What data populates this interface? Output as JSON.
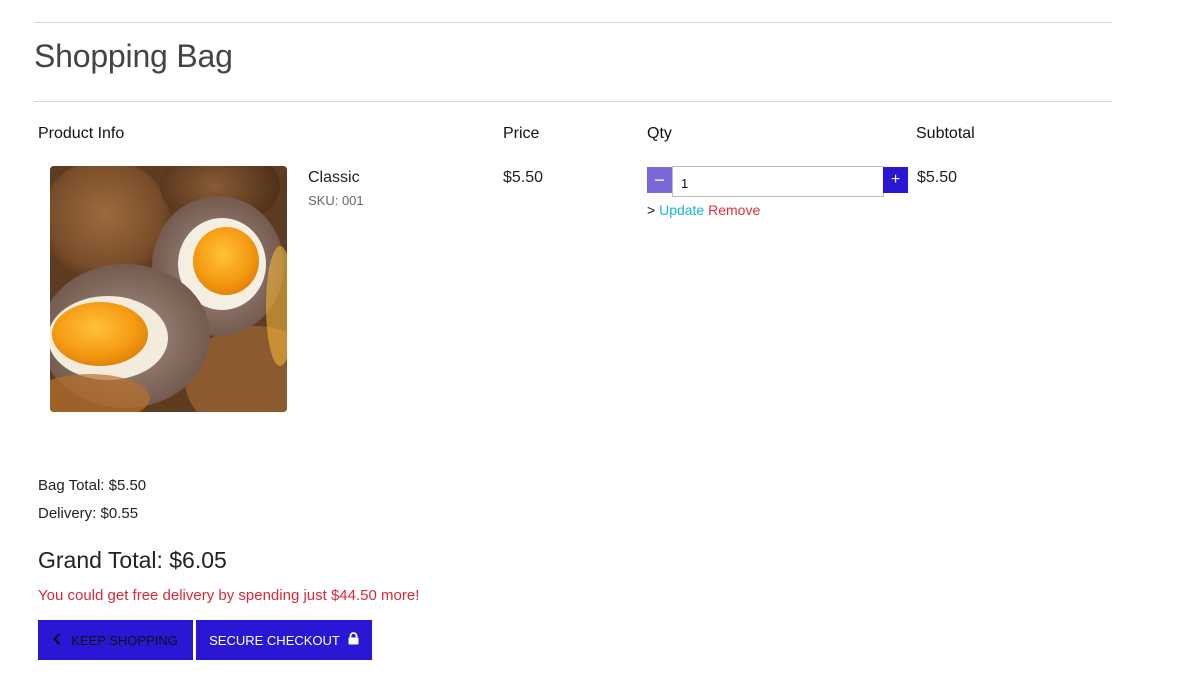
{
  "page": {
    "title": "Shopping Bag"
  },
  "table": {
    "headers": {
      "product": "Product Info",
      "price": "Price",
      "qty": "Qty",
      "subtotal": "Subtotal"
    }
  },
  "item": {
    "name": "Classic",
    "sku": "SKU: 001",
    "price": "$5.50",
    "qty": "1",
    "subtotal": "$5.50",
    "image_icon": "scotch-egg-photo"
  },
  "qty_controls": {
    "minus": "−",
    "plus": "+",
    "prefix": ">",
    "update": "Update",
    "remove": "Remove"
  },
  "totals": {
    "bag_total": "Bag Total: $5.50",
    "delivery": "Delivery: $0.55",
    "grand_total": "Grand Total: $6.05",
    "free_delivery_msg": "You could get free delivery by spending just $44.50 more!"
  },
  "buttons": {
    "keep_shopping": "KEEP SHOPPING",
    "keep_icon": "chevron-left-icon",
    "checkout": "SECURE CHECKOUT",
    "checkout_icon": "lock-icon"
  },
  "colors": {
    "accent": "#2a17d6",
    "minus_button": "#7b68d8",
    "update_link": "#1ab4d8",
    "remove_link": "#e0303a",
    "notice": "#d9283a"
  }
}
